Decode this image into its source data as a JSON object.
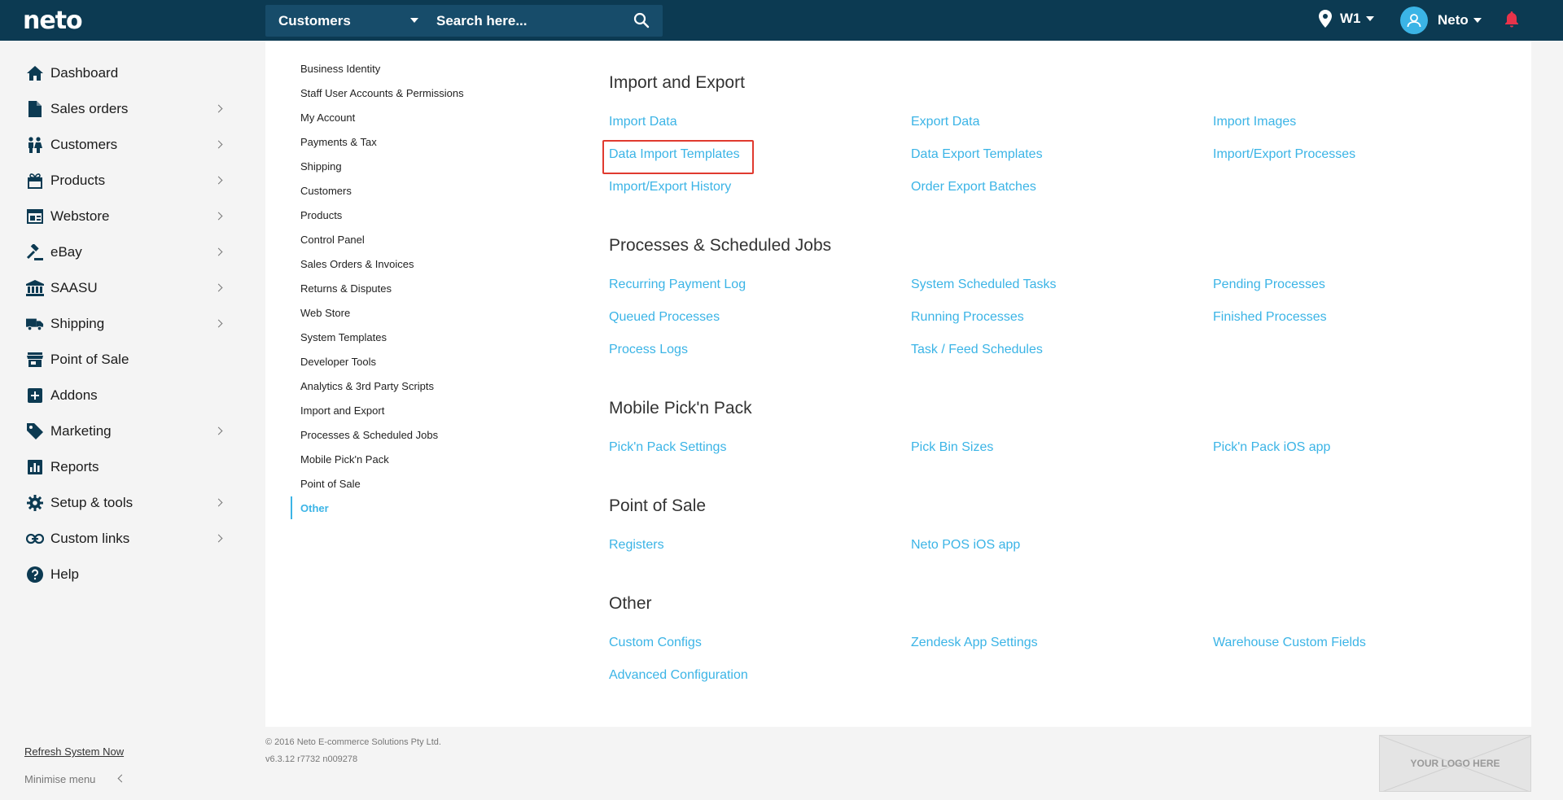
{
  "topbar": {
    "logo": "neto",
    "search_scope": "Customers",
    "search_placeholder": "Search here...",
    "location": "W1",
    "user_name": "Neto"
  },
  "sidebar": {
    "items": [
      {
        "label": "Dashboard",
        "icon": "home-icon",
        "chevron": false
      },
      {
        "label": "Sales orders",
        "icon": "document-icon",
        "chevron": true
      },
      {
        "label": "Customers",
        "icon": "users-icon",
        "chevron": true
      },
      {
        "label": "Products",
        "icon": "gift-icon",
        "chevron": true
      },
      {
        "label": "Webstore",
        "icon": "browser-icon",
        "chevron": true
      },
      {
        "label": "eBay",
        "icon": "gavel-icon",
        "chevron": true
      },
      {
        "label": "SAASU",
        "icon": "bank-icon",
        "chevron": true
      },
      {
        "label": "Shipping",
        "icon": "truck-icon",
        "chevron": true
      },
      {
        "label": "Point of Sale",
        "icon": "store-icon",
        "chevron": false
      },
      {
        "label": "Addons",
        "icon": "plus-box-icon",
        "chevron": false
      },
      {
        "label": "Marketing",
        "icon": "tag-icon",
        "chevron": true
      },
      {
        "label": "Reports",
        "icon": "bar-chart-icon",
        "chevron": false
      },
      {
        "label": "Setup & tools",
        "icon": "gear-icon",
        "chevron": true
      },
      {
        "label": "Custom links",
        "icon": "link-icon",
        "chevron": true
      },
      {
        "label": "Help",
        "icon": "help-icon",
        "chevron": false
      }
    ],
    "refresh_label": "Refresh System Now",
    "minimise_label": "Minimise menu"
  },
  "subnav": {
    "items": [
      "Business Identity",
      "Staff User Accounts & Permissions",
      "My Account",
      "Payments & Tax",
      "Shipping",
      "Customers",
      "Products",
      "Control Panel",
      "Sales Orders & Invoices",
      "Returns & Disputes",
      "Web Store",
      "System Templates",
      "Developer Tools",
      "Analytics & 3rd Party Scripts",
      "Import and Export",
      "Processes & Scheduled Jobs",
      "Mobile Pick'n Pack",
      "Point of Sale",
      "Other"
    ],
    "active": "Other"
  },
  "sections": [
    {
      "title": "Import and Export",
      "rows": [
        [
          "Import Data",
          "Export Data",
          "Import Images"
        ],
        [
          "Data Import Templates",
          "Data Export Templates",
          "Import/Export Processes"
        ],
        [
          "Import/Export History",
          "Order Export Batches",
          ""
        ]
      ]
    },
    {
      "title": "Processes & Scheduled Jobs",
      "rows": [
        [
          "Recurring Payment Log",
          "System Scheduled Tasks",
          "Pending Processes"
        ],
        [
          "Queued Processes",
          "Running Processes",
          "Finished Processes"
        ],
        [
          "Process Logs",
          "Task / Feed Schedules",
          ""
        ]
      ]
    },
    {
      "title": "Mobile Pick'n Pack",
      "rows": [
        [
          "Pick'n Pack Settings",
          "Pick Bin Sizes",
          "Pick'n Pack iOS app"
        ]
      ]
    },
    {
      "title": "Point of Sale",
      "rows": [
        [
          "Registers",
          "Neto POS iOS app",
          ""
        ]
      ]
    },
    {
      "title": "Other",
      "rows": [
        [
          "Custom Configs",
          "Zendesk App Settings",
          "Warehouse Custom Fields"
        ],
        [
          "Advanced Configuration",
          "",
          ""
        ]
      ]
    }
  ],
  "highlighted_link": "Data Import Templates",
  "footer": {
    "copyright": "© 2016 Neto E-commerce Solutions Pty Ltd.",
    "version": "v6.3.12 r7732 n009278",
    "logo_placeholder": "YOUR LOGO HERE"
  },
  "colors": {
    "topbar": "#0c3a52",
    "accent": "#3bb4e6",
    "highlight_border": "#e03a2f",
    "notification": "#e8334a"
  }
}
